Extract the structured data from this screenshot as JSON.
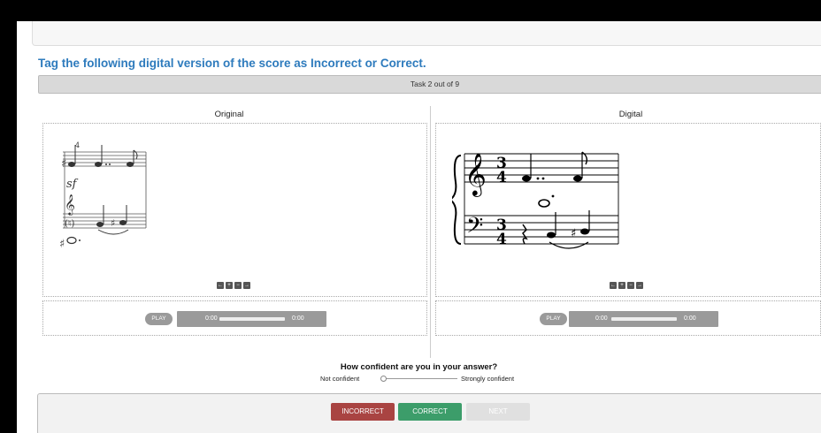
{
  "instruction": "Tag the following digital version of the score as Incorrect or Correct.",
  "task_progress": "Task 2 out of 9",
  "columns": {
    "original": {
      "title": "Original",
      "player": {
        "play_label": "PLAY",
        "time_current": "0:00",
        "time_total": "0:00"
      }
    },
    "digital": {
      "title": "Digital",
      "player": {
        "play_label": "PLAY",
        "time_current": "0:00",
        "time_total": "0:00"
      }
    }
  },
  "score": {
    "measure_number": "4",
    "dynamic": "sf",
    "time_signature_top": "3",
    "time_signature_bottom": "4",
    "zoom_controls": [
      "←",
      "+",
      "−",
      "→"
    ]
  },
  "confidence": {
    "question": "How confident are you in your answer?",
    "min_label": "Not confident",
    "max_label": "Strongly confident",
    "value": 0
  },
  "buttons": {
    "incorrect": "INCORRECT",
    "correct": "CORRECT",
    "next": "NEXT"
  },
  "colors": {
    "heading": "#2e7bbd",
    "incorrect": "#a94442",
    "correct": "#3c9d6a",
    "next_disabled": "#e0e0e0"
  }
}
